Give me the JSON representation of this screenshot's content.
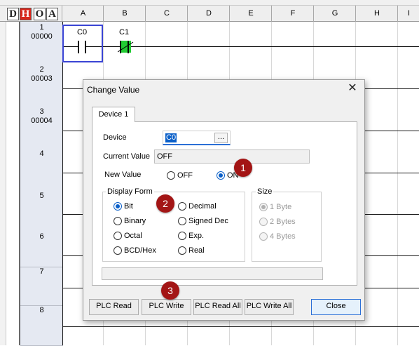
{
  "header": {
    "mode_buttons": [
      "D",
      "H",
      "O",
      "A"
    ],
    "active_mode": "H",
    "columns": [
      "A",
      "B",
      "C",
      "D",
      "E",
      "F",
      "G",
      "H",
      "I"
    ]
  },
  "rows": [
    {
      "num": "1",
      "addr": "00000"
    },
    {
      "num": "2",
      "addr": "00003"
    },
    {
      "num": "3",
      "addr": "00004"
    },
    {
      "num": "4",
      "addr": ""
    },
    {
      "num": "5",
      "addr": ""
    },
    {
      "num": "6",
      "addr": ""
    },
    {
      "num": "7",
      "addr": ""
    },
    {
      "num": "8",
      "addr": ""
    }
  ],
  "ladder": {
    "contact1_label": "C0",
    "contact2_label": "C1",
    "contact2_state_color": "#22cc33"
  },
  "dialog": {
    "title": "Change Value",
    "tab_label": "Device 1",
    "device_label": "Device",
    "device_value": "C0",
    "browse_label": "...",
    "current_value_label": "Current Value",
    "current_value": "OFF",
    "new_value_label": "New Value",
    "new_value_options": [
      {
        "label": "OFF",
        "checked": false
      },
      {
        "label": "ON",
        "checked": true
      }
    ],
    "display_form": {
      "title": "Display Form",
      "options": [
        {
          "label": "Bit",
          "checked": true
        },
        {
          "label": "Decimal",
          "checked": false
        },
        {
          "label": "Binary",
          "checked": false
        },
        {
          "label": "Signed Dec",
          "checked": false
        },
        {
          "label": "Octal",
          "checked": false
        },
        {
          "label": "Exp.",
          "checked": false
        },
        {
          "label": "BCD/Hex",
          "checked": false
        },
        {
          "label": "Real",
          "checked": false
        }
      ]
    },
    "size": {
      "title": "Size",
      "options": [
        {
          "label": "1 Byte",
          "checked": true,
          "disabled": true
        },
        {
          "label": "2 Bytes",
          "checked": false,
          "disabled": true
        },
        {
          "label": "4 Bytes",
          "checked": false,
          "disabled": true
        }
      ]
    },
    "buttons": {
      "plc_read": "PLC Read",
      "plc_write": "PLC Write",
      "plc_read_all": "PLC Read All",
      "plc_write_all": "PLC Write All",
      "close": "Close"
    }
  },
  "annotations": [
    "1",
    "2",
    "3"
  ],
  "colors": {
    "accent_blue": "#0a5fc8",
    "badge_red": "#a31515",
    "cursor_blue": "#3a44d4",
    "mode_active_red": "#d9271c"
  }
}
